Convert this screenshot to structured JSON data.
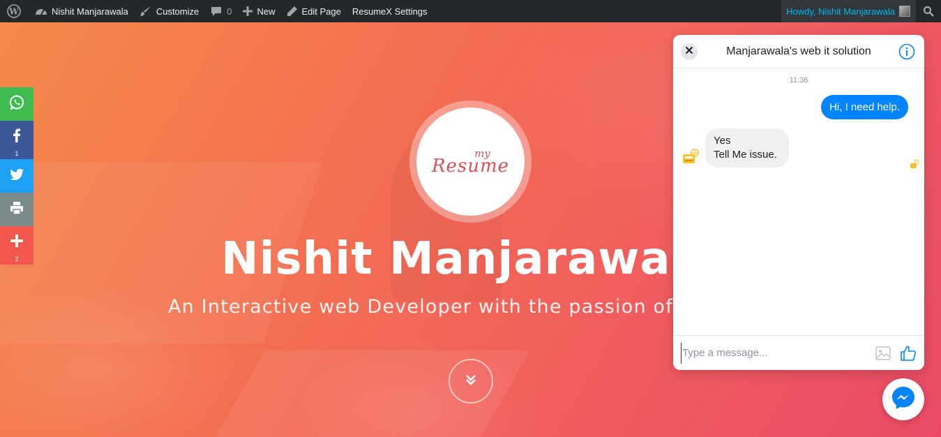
{
  "adminbar": {
    "site_name": "Nishit Manjarawala",
    "customize": "Customize",
    "comments_count": "0",
    "new": "New",
    "edit_page": "Edit Page",
    "settings": "ResumeX Settings",
    "howdy": "Howdy, Nishit Manjarawala"
  },
  "share": {
    "facebook_count": "1",
    "more_count": "2"
  },
  "hero": {
    "logo_small": "my",
    "logo_main": "Resume",
    "name": "Nishit Manjarawal",
    "tagline": "An Interactive web Developer with the passion of"
  },
  "chat": {
    "title": "Manjarawala's web it solution",
    "time": "11:36",
    "outgoing": "Hi, I need help.",
    "incoming_line1": "Yes",
    "incoming_line2": "Tell Me issue.",
    "input_placeholder": "Type a message...",
    "input_value": ""
  },
  "colors": {
    "adminbar_bg": "#23282d",
    "howdy_text": "#00b9eb",
    "messenger_blue": "#0084ff",
    "whatsapp": "#3ebc50",
    "facebook": "#3b5998",
    "twitter": "#1da1f2",
    "print": "#7b8a8b",
    "more": "#f2574e"
  },
  "icons": {
    "adminbar": [
      "wordpress-icon",
      "dashboard-icon",
      "brush-icon",
      "comment-icon",
      "plus-icon",
      "pencil-icon",
      "search-icon"
    ],
    "share": [
      "whatsapp-icon",
      "facebook-icon",
      "twitter-icon",
      "print-icon",
      "plus-icon"
    ],
    "chat": [
      "close-icon",
      "info-icon",
      "bot-avatar-icon",
      "read-receipt-icon",
      "image-icon",
      "thumbs-up-icon",
      "messenger-icon"
    ],
    "hero": [
      "chevron-double-down-icon"
    ]
  }
}
